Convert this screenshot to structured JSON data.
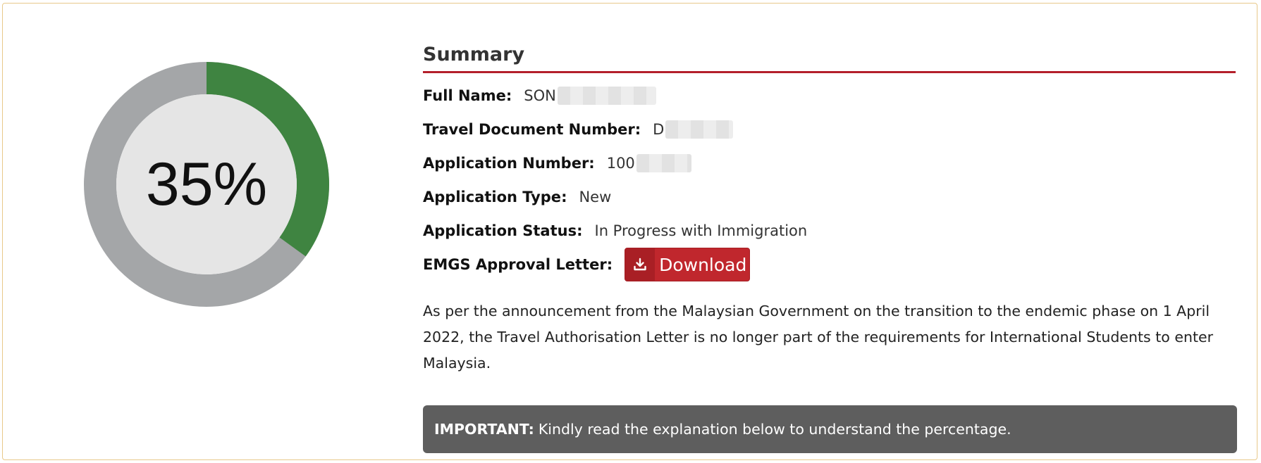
{
  "progress": {
    "percent": 35,
    "display": "35%",
    "colors": {
      "filled": "#3f8441",
      "remaining": "#a4a6a8",
      "center": "#e5e5e5"
    }
  },
  "summary": {
    "title": "Summary",
    "full_name": {
      "label": "Full Name",
      "colon": ":",
      "value": "SON"
    },
    "travel_document": {
      "label": "Travel Document Number",
      "colon": ":",
      "value": "D"
    },
    "application_number": {
      "label": "Application Number",
      "colon": ":",
      "value": "100"
    },
    "application_type": {
      "label": "Application Type",
      "colon": ":",
      "value": "New"
    },
    "application_status": {
      "label": "Application Status",
      "colon": ":",
      "value": "In Progress with Immigration"
    },
    "approval_letter": {
      "label": "EMGS Approval Letter",
      "colon": ":",
      "button_label": "Download",
      "icon": "download-icon"
    },
    "notice": "As per the announcement from the Malaysian Government on the transition to the endemic phase on 1 April 2022, the Travel Authorisation Letter is no longer part of the requirements for International Students to enter Malaysia."
  },
  "important": {
    "prefix": "IMPORTANT:",
    "text": "Kindly read the explanation below to understand the percentage."
  },
  "colors": {
    "accent": "#b41f2b",
    "button": "#c0272d",
    "important_bg": "#5e5e5e",
    "card_border": "#e8c98a"
  }
}
